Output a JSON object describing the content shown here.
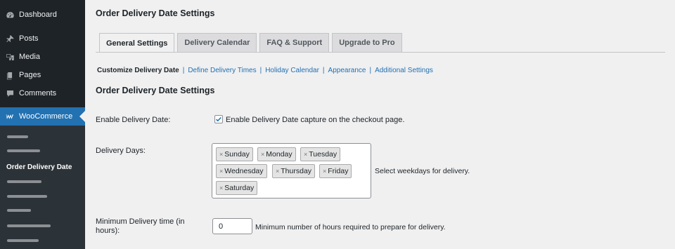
{
  "sidebar": {
    "items": [
      {
        "label": "Dashboard",
        "icon": "dashboard-icon"
      },
      {
        "label": "Posts",
        "icon": "pin-icon"
      },
      {
        "label": "Media",
        "icon": "media-icon"
      },
      {
        "label": "Pages",
        "icon": "pages-icon"
      },
      {
        "label": "Comments",
        "icon": "comment-icon"
      },
      {
        "label": "WooCommerce",
        "icon": "woocommerce-icon"
      }
    ],
    "submenu_current": "Order Delivery Date"
  },
  "page": {
    "title": "Order Delivery Date Settings",
    "tabs": [
      "General Settings",
      "Delivery Calendar",
      "FAQ & Support",
      "Upgrade to Pro"
    ],
    "subnav": {
      "current": "Customize Delivery Date",
      "links": [
        "Define Delivery Times",
        "Holiday Calendar",
        "Appearance",
        "Additional Settings"
      ]
    },
    "section_title": "Order Delivery Date Settings"
  },
  "fields": {
    "enable": {
      "label": "Enable Delivery Date:",
      "checked": true,
      "text": "Enable Delivery Date capture on the checkout page."
    },
    "days": {
      "label": "Delivery Days:",
      "chips": [
        "Sunday",
        "Monday",
        "Tuesday",
        "Wednesday",
        "Thursday",
        "Friday",
        "Saturday"
      ],
      "remove_glyph": "×",
      "description": "Select weekdays for delivery."
    },
    "min_time": {
      "label_line1": "Minimum Delivery time (in",
      "label_line2": "hours):",
      "value": "0",
      "description": "Minimum number of hours required to prepare for delivery."
    }
  },
  "colors": {
    "sidebar_bg": "#1d2327",
    "accent": "#2271b1",
    "page_bg": "#f0f0f1"
  }
}
